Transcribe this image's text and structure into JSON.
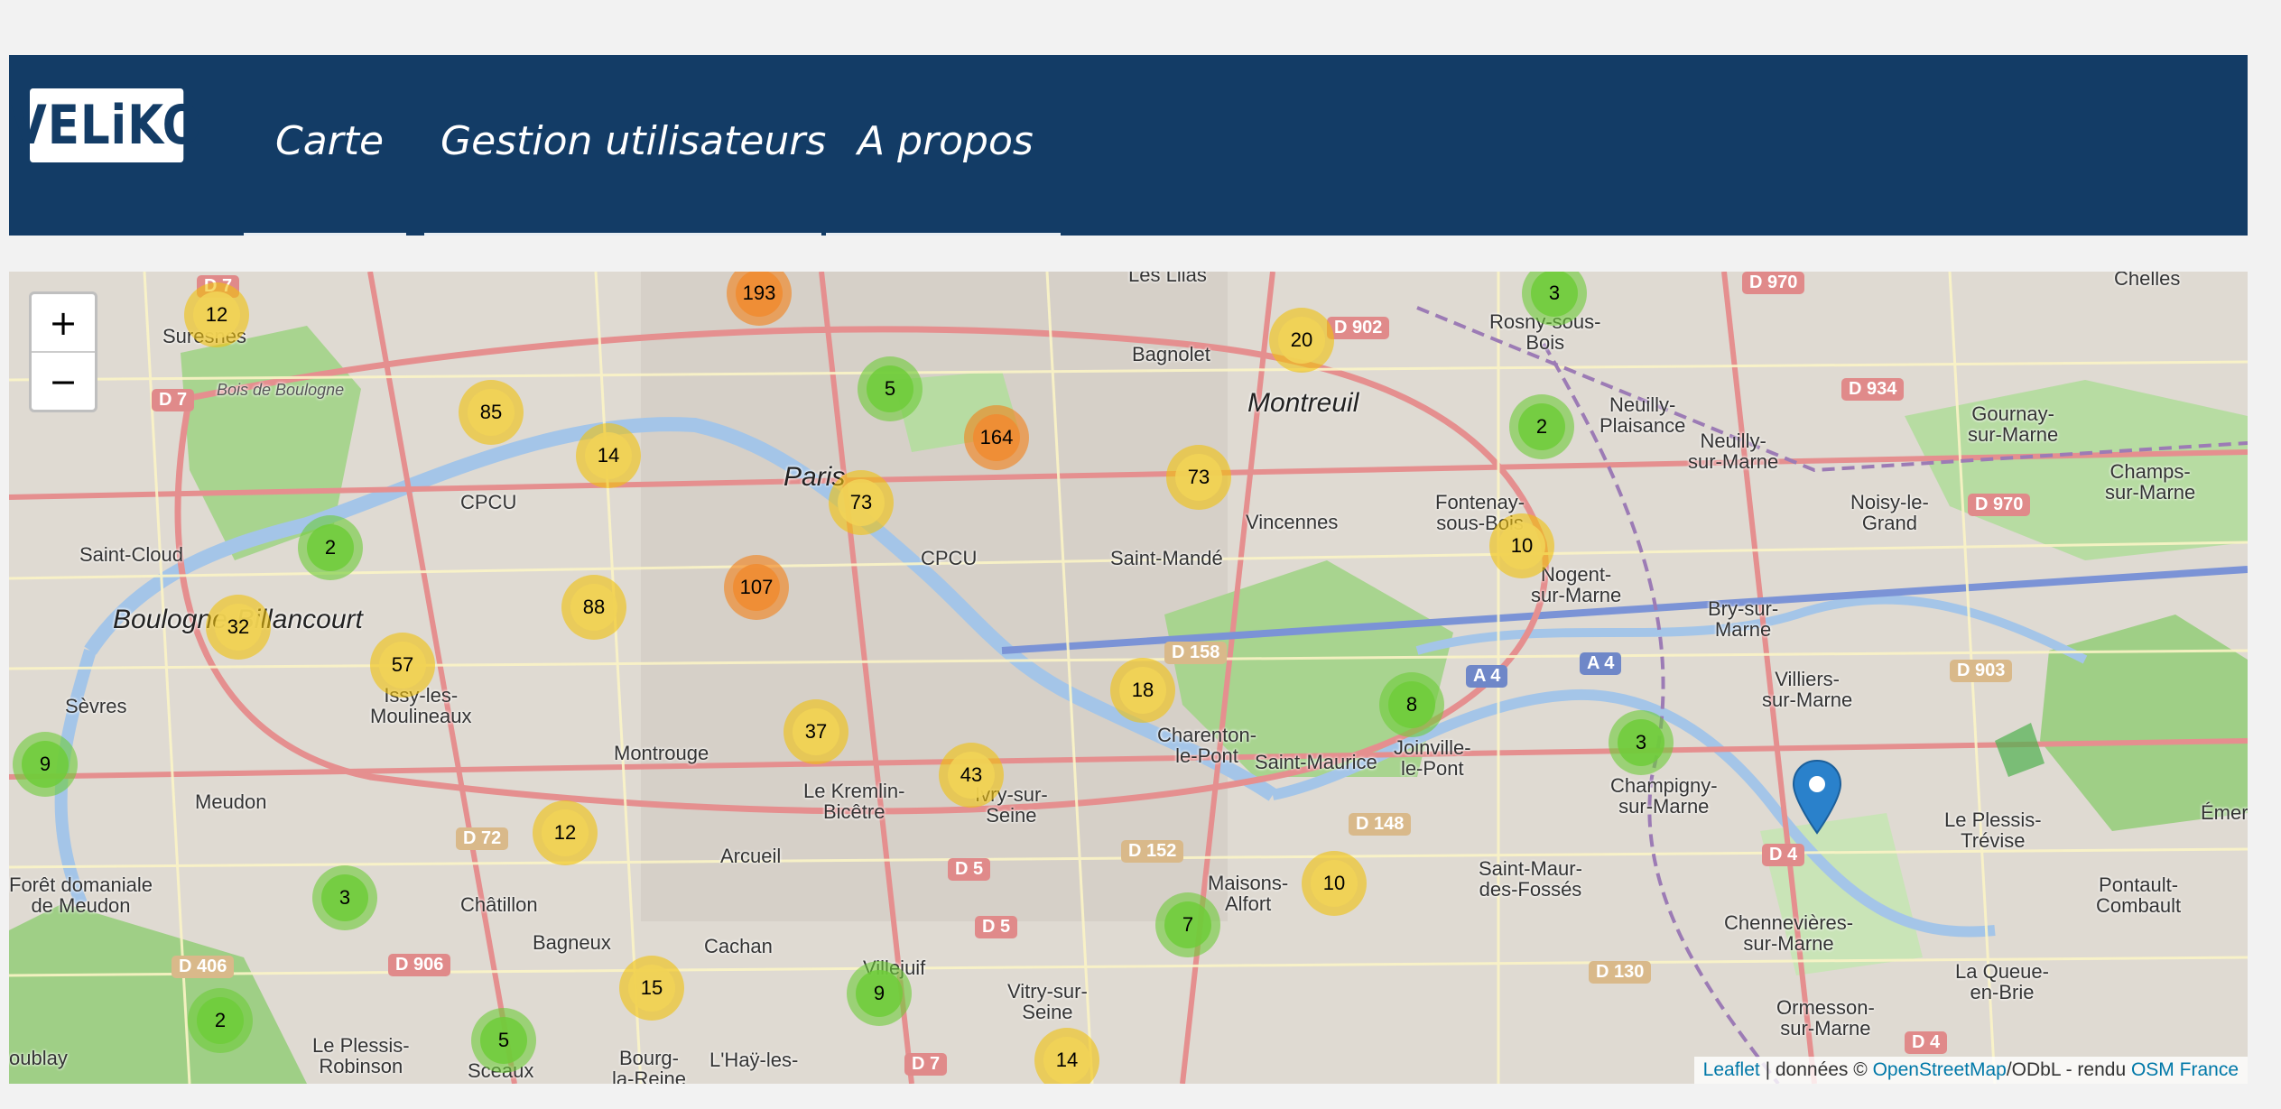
{
  "navbar": {
    "logo": "VELiKO",
    "links": [
      "Carte",
      "Gestion utilisateurs",
      "A propos"
    ]
  },
  "map": {
    "zoom_in": "+",
    "zoom_out": "−",
    "place_labels": [
      {
        "text": "Suresnes",
        "size": "mid"
      },
      {
        "text": "Bois de Boulogne",
        "size": "sm"
      },
      {
        "text": "Saint-Cloud",
        "size": "mid"
      },
      {
        "text": "Boulogne-Billancourt",
        "size": "big"
      },
      {
        "text": "Sèvres",
        "size": "mid"
      },
      {
        "text": "Meudon",
        "size": "mid"
      },
      {
        "text": "Forêt domaniale\nde Meudon",
        "size": "mid"
      },
      {
        "text": "Le Plessis-\nRobinson",
        "size": "mid"
      },
      {
        "text": "Sceaux",
        "size": "mid"
      },
      {
        "text": "Châtillon",
        "size": "mid"
      },
      {
        "text": "Bagneux",
        "size": "mid"
      },
      {
        "text": "Montrouge",
        "size": "mid"
      },
      {
        "text": "Arcueil",
        "size": "mid"
      },
      {
        "text": "Cachan",
        "size": "mid"
      },
      {
        "text": "Issy-les-\nMoulineaux",
        "size": "mid"
      },
      {
        "text": "Paris",
        "size": "big"
      },
      {
        "text": "Le Kremlin-\nBicêtre",
        "size": "mid"
      },
      {
        "text": "Ivry-sur-\nSeine",
        "size": "mid"
      },
      {
        "text": "Villejuif",
        "size": "mid"
      },
      {
        "text": "Vitry-sur-\nSeine",
        "size": "mid"
      },
      {
        "text": "Charenton-\nle-Pont",
        "size": "mid"
      },
      {
        "text": "Saint-Maurice",
        "size": "mid"
      },
      {
        "text": "Maisons-\nAlfort",
        "size": "mid"
      },
      {
        "text": "Saint-Mandé",
        "size": "mid"
      },
      {
        "text": "Vincennes",
        "size": "mid"
      },
      {
        "text": "Montreuil",
        "size": "big"
      },
      {
        "text": "Bagnolet",
        "size": "mid"
      },
      {
        "text": "Fontenay-\nsous-Bois",
        "size": "mid"
      },
      {
        "text": "Rosny-sous-\nBois",
        "size": "mid"
      },
      {
        "text": "Neuilly-\nPlaisance",
        "size": "mid"
      },
      {
        "text": "Neuilly-\nsur-Marne",
        "size": "mid"
      },
      {
        "text": "Nogent-\nsur-Marne",
        "size": "mid"
      },
      {
        "text": "Joinville-\nle-Pont",
        "size": "mid"
      },
      {
        "text": "Bry-sur-\nMarne",
        "size": "mid"
      },
      {
        "text": "Champigny-\nsur-Marne",
        "size": "mid"
      },
      {
        "text": "Saint-Maur-\ndes-Fossés",
        "size": "mid"
      },
      {
        "text": "Villiers-\nsur-Marne",
        "size": "mid"
      },
      {
        "text": "Chennevières-\nsur-Marne",
        "size": "mid"
      },
      {
        "text": "Ormesson-\nsur-Marne",
        "size": "mid"
      },
      {
        "text": "Le Plessis-\nTrévise",
        "size": "mid"
      },
      {
        "text": "La Queue-\nen-Brie",
        "size": "mid"
      },
      {
        "text": "Pontault-\nCombault",
        "size": "mid"
      },
      {
        "text": "Noisy-le-\nGrand",
        "size": "mid"
      },
      {
        "text": "Gournay-\nsur-Marne",
        "size": "mid"
      },
      {
        "text": "Champs-\nsur-Marne",
        "size": "mid"
      },
      {
        "text": "Chelles",
        "size": "mid"
      },
      {
        "text": "Émera",
        "size": "mid"
      },
      {
        "text": "oublay",
        "size": "mid"
      },
      {
        "text": "Bourg-\nla-Reine",
        "size": "mid"
      },
      {
        "text": "L'Haÿ-les-",
        "size": "mid"
      },
      {
        "text": "Les Lilas",
        "size": "mid"
      },
      {
        "text": "CPCU",
        "size": "mid"
      },
      {
        "text": "CPCU",
        "size": "mid"
      }
    ],
    "road_labels": [
      {
        "text": "D 7",
        "style": "red"
      },
      {
        "text": "D 7",
        "style": "red"
      },
      {
        "text": "D 970",
        "style": "red"
      },
      {
        "text": "D 902",
        "style": "red"
      },
      {
        "text": "D 934",
        "style": "red"
      },
      {
        "text": "D 970",
        "style": "red"
      },
      {
        "text": "D 158",
        "style": "tan"
      },
      {
        "text": "A 4",
        "style": "blue"
      },
      {
        "text": "A 4",
        "style": "blue"
      },
      {
        "text": "D 903",
        "style": "tan"
      },
      {
        "text": "D 72",
        "style": "tan"
      },
      {
        "text": "D 906",
        "style": "red"
      },
      {
        "text": "D 406",
        "style": "tan"
      },
      {
        "text": "D 5",
        "style": "red"
      },
      {
        "text": "D 5",
        "style": "red"
      },
      {
        "text": "D 152",
        "style": "tan"
      },
      {
        "text": "D 148",
        "style": "tan"
      },
      {
        "text": "D 130",
        "style": "tan"
      },
      {
        "text": "D 4",
        "style": "red"
      },
      {
        "text": "D 4",
        "style": "red"
      },
      {
        "text": "D 7",
        "style": "red"
      }
    ],
    "clusters": [
      {
        "count": "12",
        "level": "medium"
      },
      {
        "count": "193",
        "level": "large"
      },
      {
        "count": "5",
        "level": "small"
      },
      {
        "count": "20",
        "level": "medium"
      },
      {
        "count": "3",
        "level": "small"
      },
      {
        "count": "85",
        "level": "medium"
      },
      {
        "count": "14",
        "level": "medium"
      },
      {
        "count": "164",
        "level": "large"
      },
      {
        "count": "73",
        "level": "medium"
      },
      {
        "count": "2",
        "level": "small"
      },
      {
        "count": "73",
        "level": "medium"
      },
      {
        "count": "2",
        "level": "small"
      },
      {
        "count": "10",
        "level": "medium"
      },
      {
        "count": "107",
        "level": "large"
      },
      {
        "count": "88",
        "level": "medium"
      },
      {
        "count": "32",
        "level": "medium"
      },
      {
        "count": "57",
        "level": "medium"
      },
      {
        "count": "18",
        "level": "medium"
      },
      {
        "count": "8",
        "level": "small"
      },
      {
        "count": "3",
        "level": "small"
      },
      {
        "count": "37",
        "level": "medium"
      },
      {
        "count": "43",
        "level": "medium"
      },
      {
        "count": "9",
        "level": "small"
      },
      {
        "count": "12",
        "level": "medium"
      },
      {
        "count": "3",
        "level": "small"
      },
      {
        "count": "10",
        "level": "medium"
      },
      {
        "count": "7",
        "level": "small"
      },
      {
        "count": "15",
        "level": "medium"
      },
      {
        "count": "9",
        "level": "small"
      },
      {
        "count": "2",
        "level": "small"
      },
      {
        "count": "5",
        "level": "small"
      },
      {
        "count": "14",
        "level": "medium"
      }
    ],
    "marker": {
      "icon": "map-pin-icon",
      "color": "#2a81cb"
    },
    "attribution": {
      "leaflet": "Leaflet",
      "sep": " | données © ",
      "osm": "OpenStreetMap",
      "license": "/ODbL - rendu ",
      "osmfr": "OSM France"
    }
  },
  "colors": {
    "navbar": "#133c66",
    "cluster_small": "#6ecc39",
    "cluster_medium": "#f0c20c",
    "cluster_large": "#f18017"
  }
}
